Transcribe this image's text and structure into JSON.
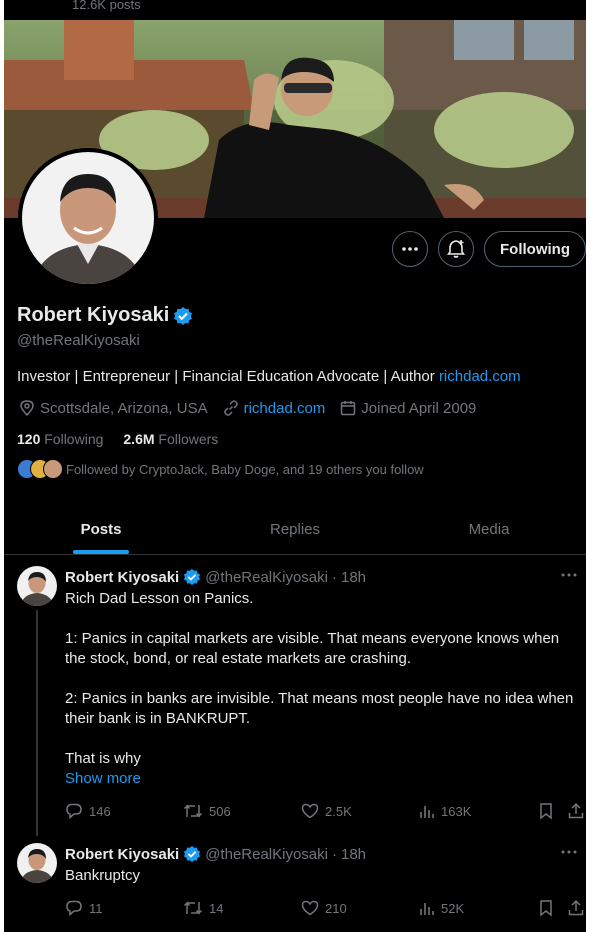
{
  "header": {
    "posts_count": "12.6K posts"
  },
  "profile": {
    "name": "Robert Kiyosaki",
    "handle": "@theRealKiyosaki",
    "bio_text": "Investor | Entrepreneur | Financial Education Advocate | Author ",
    "bio_link": "richdad.com",
    "location": "Scottsdale, Arizona, USA",
    "website": "richdad.com",
    "joined": "Joined April 2009",
    "following_count": "120",
    "following_label": "Following",
    "followers_count": "2.6M",
    "followers_label": "Followers",
    "followed_by": "Followed by CryptoJack, Baby Doge, and 19 others you follow",
    "follow_button": "Following"
  },
  "tabs": [
    {
      "label": "Posts",
      "active": true
    },
    {
      "label": "Replies",
      "active": false
    },
    {
      "label": "Media",
      "active": false
    }
  ],
  "tweets": [
    {
      "name": "Robert Kiyosaki",
      "handle": "@theRealKiyosaki",
      "separator": "·",
      "time": "18h",
      "lines": [
        "Rich Dad Lesson on Panics.",
        "",
        "1:  Panics in capital markets are visible.  That means everyone knows when the stock, bond, or real estate markets are crashing.",
        "",
        "2:  Panics in banks are invisible. That means most people have no idea when their bank is in BANKRUPT.",
        "",
        "That is why"
      ],
      "show_more": "Show more",
      "replies": "146",
      "reposts": "506",
      "likes": "2.5K",
      "views": "163K"
    },
    {
      "name": "Robert Kiyosaki",
      "handle": "@theRealKiyosaki",
      "separator": "·",
      "time": "18h",
      "lines": [
        "Bankruptcy"
      ],
      "replies": "11",
      "reposts": "14",
      "likes": "210",
      "views": "52K"
    }
  ],
  "colors": {
    "accent": "#1d9bf0",
    "verified": "#1d9bf0",
    "background": "#000000",
    "muted": "#71767b"
  },
  "icons": [
    "more-icon",
    "notify-bell-icon",
    "verified-badge-icon",
    "location-icon",
    "link-icon",
    "calendar-icon",
    "reply-icon",
    "repost-icon",
    "like-icon",
    "views-icon",
    "bookmark-icon",
    "share-icon"
  ]
}
